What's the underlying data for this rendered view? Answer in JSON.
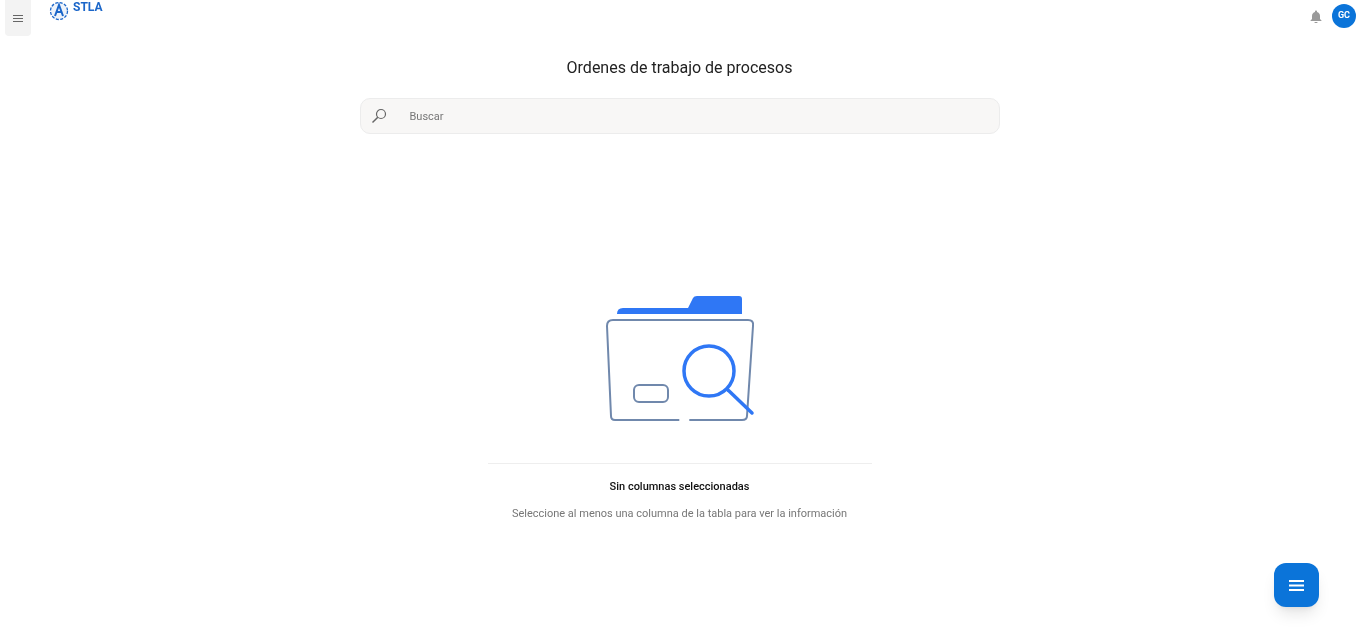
{
  "header": {
    "brand": "STLA",
    "avatar": "GC"
  },
  "page": {
    "title": "Ordenes de trabajo de procesos",
    "search": {
      "placeholder": "Buscar"
    }
  },
  "empty_state": {
    "title": "Sin columnas seleccionadas",
    "message": "Seleccione al menos una columna de la tabla para ver la información"
  }
}
